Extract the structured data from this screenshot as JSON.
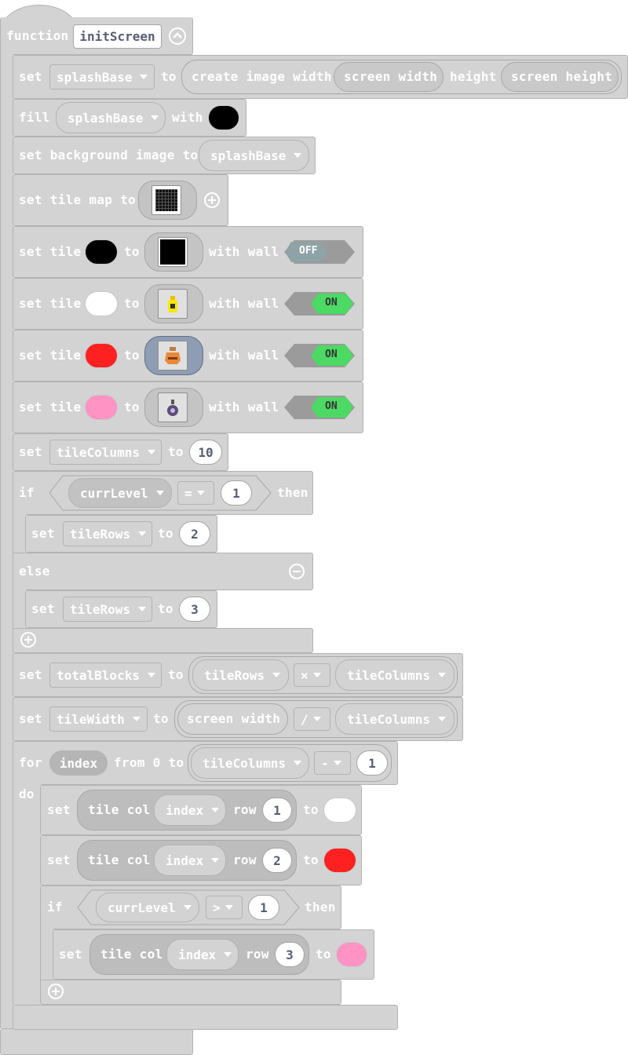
{
  "function_block": {
    "keyword": "function",
    "name": "initScreen"
  },
  "row1": {
    "set": "set",
    "var": "splashBase",
    "to": "to",
    "create": "create image width",
    "w_value": "screen width",
    "height_label": "height",
    "h_value": "screen height"
  },
  "row2": {
    "fill": "fill",
    "var": "splashBase",
    "with": "with",
    "color": "#000000"
  },
  "row3": {
    "label": "set background image to",
    "var": "splashBase"
  },
  "row4": {
    "label": "set tile map to",
    "icon": "tilemap-thumbnail"
  },
  "tiles": [
    {
      "set": "set tile",
      "to": "to",
      "wall_label": "with wall",
      "color": "#000000",
      "wall": "OFF",
      "image": "black-square-tile"
    },
    {
      "set": "set tile",
      "to": "to",
      "wall_label": "with wall",
      "color": "#ffffff",
      "wall": "ON",
      "image": "yellow-bottle-sprite"
    },
    {
      "set": "set tile",
      "to": "to",
      "wall_label": "with wall",
      "color": "#ff2121",
      "wall": "ON",
      "image": "orange-vase-sprite"
    },
    {
      "set": "set tile",
      "to": "to",
      "wall_label": "with wall",
      "color": "#ff93c4",
      "wall": "ON",
      "image": "purple-potion-sprite"
    }
  ],
  "row9": {
    "set": "set",
    "var": "tileColumns",
    "to": "to",
    "value": "10"
  },
  "if1": {
    "if": "if",
    "var": "currLevel",
    "op": "=",
    "value": "1",
    "then": "then",
    "else": "else"
  },
  "if1_body": {
    "set": "set",
    "var": "tileRows",
    "to": "to",
    "value": "2"
  },
  "else_body": {
    "set": "set",
    "var": "tileRows",
    "to": "to",
    "value": "3"
  },
  "row_total": {
    "set": "set",
    "var": "totalBlocks",
    "to": "to",
    "a": "tileRows",
    "op": "×",
    "b": "tileColumns"
  },
  "row_width": {
    "set": "set",
    "var": "tileWidth",
    "to": "to",
    "a": "screen width",
    "op": "/",
    "b": "tileColumns"
  },
  "for_loop": {
    "for": "for",
    "var": "index",
    "from": "from 0 to",
    "a": "tileColumns",
    "op": "-",
    "value": "1",
    "do": "do"
  },
  "loop_rows": [
    {
      "set": "set",
      "tile_col": "tile col",
      "var": "index",
      "row": "row",
      "row_value": "1",
      "to": "to",
      "color": "#ffffff"
    },
    {
      "set": "set",
      "tile_col": "tile col",
      "var": "index",
      "row": "row",
      "row_value": "2",
      "to": "to",
      "color": "#ff2121"
    }
  ],
  "if2": {
    "if": "if",
    "var": "currLevel",
    "op": ">",
    "value": "1",
    "then": "then"
  },
  "if2_body": {
    "set": "set",
    "tile_col": "tile col",
    "var": "index",
    "row": "row",
    "row_value": "3",
    "to": "to",
    "color": "#ff93c4"
  }
}
